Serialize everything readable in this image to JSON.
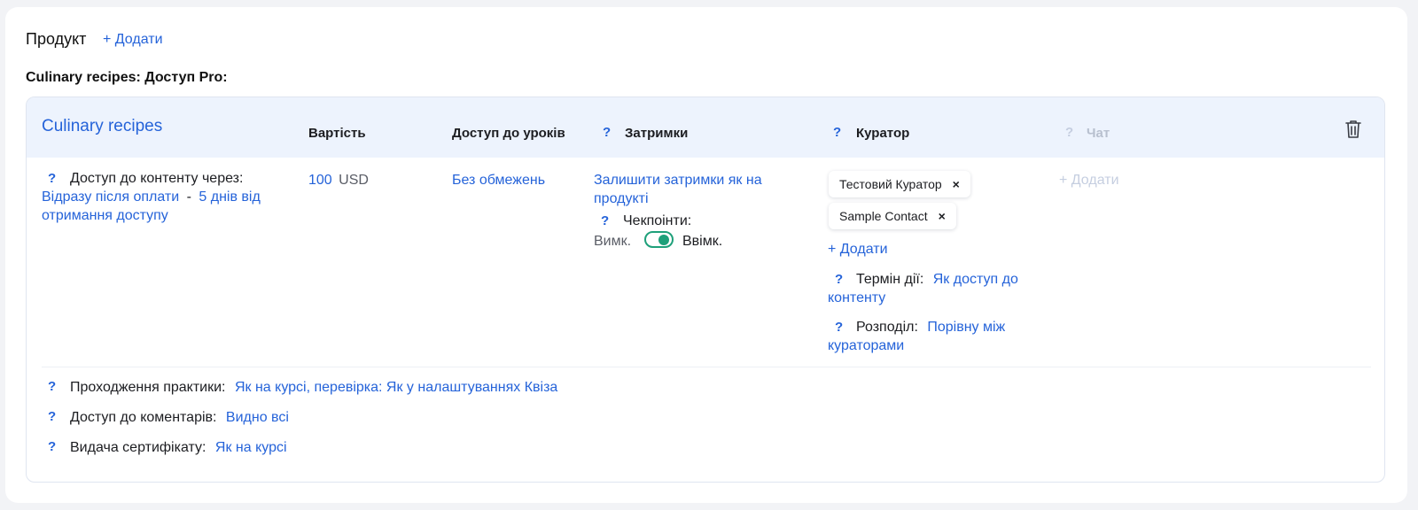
{
  "header": {
    "title": "Продукт",
    "add_label": "+ Додати",
    "section_title": "Culinary recipes: Доступ Pro:"
  },
  "panel": {
    "course_name": "Culinary recipes",
    "columns": {
      "price": "Вартість",
      "lesson_access": "Доступ до уроків",
      "delays": "Затримки",
      "curator": "Куратор",
      "chat": "Чат"
    },
    "help_mark": "?",
    "content_access": {
      "label": "Доступ до контенту через:",
      "option1": "Відразу після оплати",
      "separator": "-",
      "option2": "5 днів від отримання доступу"
    },
    "price": {
      "amount": "100",
      "currency": "USD"
    },
    "lesson_access_value": "Без обмежень",
    "delays": {
      "value": "Залишити затримки як на продукті",
      "checkpoints_label": "Чекпоінти:",
      "off_label": "Вимк.",
      "on_label": "Ввімк.",
      "checkpoints_enabled": true
    },
    "curator": {
      "chips": [
        "Тестовий Куратор",
        "Sample Contact"
      ],
      "remove_icon": "×",
      "add_label": "+ Додати",
      "term_label": "Термін дії:",
      "term_value": "Як доступ до контенту",
      "distribution_label": "Розподіл:",
      "distribution_value": "Порівну між кураторами"
    },
    "chat": {
      "add_label": "+ Додати"
    },
    "bottom": {
      "practice_label": "Проходження практики:",
      "practice_value": "Як на курсі, перевірка: Як у налаштуваннях Квіза",
      "comments_label": "Доступ до коментарів:",
      "comments_value": "Видно всі",
      "certificate_label": "Видача сертифікату:",
      "certificate_value": "Як на курсі"
    }
  },
  "colors": {
    "accent": "#2563d9",
    "toggle_on": "#1ea07a",
    "header_bg": "#edf3fd"
  }
}
